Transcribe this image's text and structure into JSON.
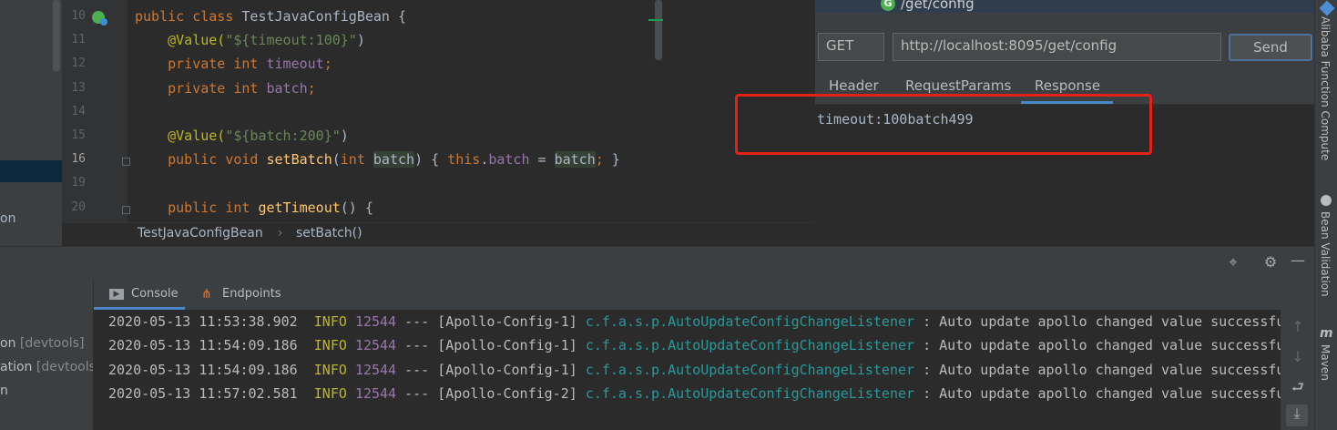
{
  "project_tree": {
    "partial_label": "on"
  },
  "editor": {
    "lines": [
      {
        "num": "10",
        "tokens": [
          [
            "kw",
            "public class "
          ],
          [
            "plain",
            "TestJavaConfigBean {"
          ]
        ]
      },
      {
        "num": "11",
        "tokens": [
          [
            "ann",
            "    @Value("
          ],
          [
            "str",
            "\"${timeout:100}\""
          ],
          [
            "plain",
            ")"
          ]
        ]
      },
      {
        "num": "12",
        "tokens": [
          [
            "kw",
            "    private int "
          ],
          [
            "fld",
            "timeout"
          ],
          [
            "kw",
            ";"
          ]
        ]
      },
      {
        "num": "13",
        "tokens": [
          [
            "kw",
            "    private int "
          ],
          [
            "fld",
            "batch"
          ],
          [
            "kw",
            ";"
          ]
        ]
      },
      {
        "num": "14",
        "tokens": []
      },
      {
        "num": "15",
        "tokens": [
          [
            "ann",
            "    @Value("
          ],
          [
            "str",
            "\"${batch:200}\""
          ],
          [
            "plain",
            ")"
          ]
        ]
      },
      {
        "num": "16",
        "tokens": [
          [
            "kw",
            "    public void "
          ],
          [
            "fn",
            "setBatch"
          ],
          [
            "plain",
            "("
          ],
          [
            "kw",
            "int "
          ],
          [
            "hl",
            "batch"
          ],
          [
            "plain",
            ") { "
          ],
          [
            "kw",
            "this"
          ],
          [
            "plain",
            "."
          ],
          [
            "fld",
            "batch"
          ],
          [
            "plain",
            " = "
          ],
          [
            "hl",
            "batch"
          ],
          [
            "kw",
            ";"
          ],
          [
            "plain",
            " }"
          ]
        ]
      },
      {
        "num": "19",
        "tokens": []
      },
      {
        "num": "20",
        "tokens": [
          [
            "kw",
            "    public int "
          ],
          [
            "fn",
            "getTimeout"
          ],
          [
            "plain",
            "() {"
          ]
        ]
      }
    ],
    "breadcrumb": [
      "TestJavaConfigBean",
      "setBatch()"
    ]
  },
  "http_client": {
    "tab_title": "/get/config",
    "method": "GET",
    "url": "http://localhost:8095/get/config",
    "send_label": "Send",
    "tabs": [
      "Header",
      "RequestParams",
      "Response"
    ],
    "active_tab": "Response",
    "response_body": "timeout:100batch499",
    "highlight_color": "#e8201a"
  },
  "right_stripe": {
    "labels": [
      "Alibaba Function Compute",
      "Bean Validation",
      "Maven"
    ]
  },
  "bottom_panel": {
    "tabs": [
      {
        "label": "Console",
        "icon": "console-icon"
      },
      {
        "label": "Endpoints",
        "icon": "endpoints-icon"
      }
    ],
    "run_items": [
      {
        "main": "on",
        "suffix": " [devtools]"
      },
      {
        "main": "ation",
        "suffix": " [devtools"
      },
      {
        "main": "n",
        "suffix": ""
      }
    ],
    "log_lines": [
      {
        "ts": "2020-05-13 11:53:38.902",
        "level": "INFO",
        "pid": "12544",
        "thread": " --- [Apollo-Config-1] ",
        "logger": "c.f.a.s.p.AutoUpdateConfigChangeListener",
        "msg": " : Auto update apollo changed value successfu"
      },
      {
        "ts": "2020-05-13 11:54:09.186",
        "level": "INFO",
        "pid": "12544",
        "thread": " --- [Apollo-Config-1] ",
        "logger": "c.f.a.s.p.AutoUpdateConfigChangeListener",
        "msg": " : Auto update apollo changed value successfu"
      },
      {
        "ts": "2020-05-13 11:54:09.186",
        "level": "INFO",
        "pid": "12544",
        "thread": " --- [Apollo-Config-1] ",
        "logger": "c.f.a.s.p.AutoUpdateConfigChangeListener",
        "msg": " : Auto update apollo changed value successfu"
      },
      {
        "ts": "2020-05-13 11:57:02.581",
        "level": "INFO",
        "pid": "12544",
        "thread": " --- [Apollo-Config-2] ",
        "logger": "c.f.a.s.p.AutoUpdateConfigChangeListener",
        "msg": " : Auto update apollo changed value successfu"
      }
    ]
  }
}
